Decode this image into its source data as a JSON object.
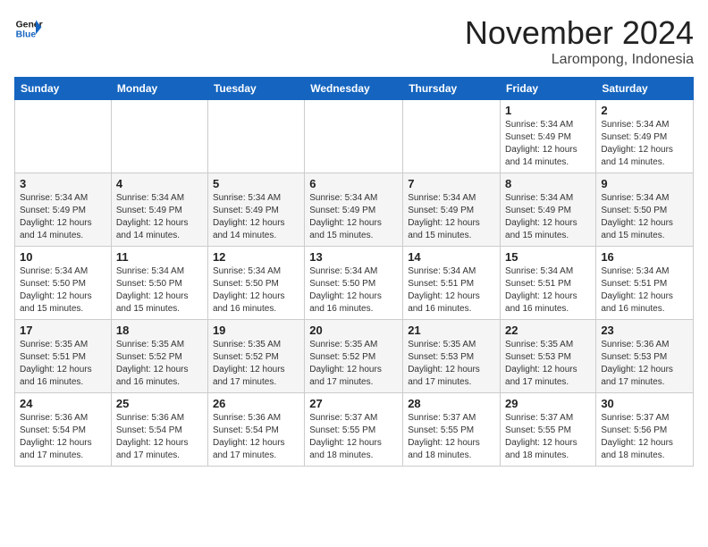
{
  "header": {
    "logo_line1": "General",
    "logo_line2": "Blue",
    "month": "November 2024",
    "location": "Larompong, Indonesia"
  },
  "days_of_week": [
    "Sunday",
    "Monday",
    "Tuesday",
    "Wednesday",
    "Thursday",
    "Friday",
    "Saturday"
  ],
  "weeks": [
    [
      {
        "day": "",
        "info": ""
      },
      {
        "day": "",
        "info": ""
      },
      {
        "day": "",
        "info": ""
      },
      {
        "day": "",
        "info": ""
      },
      {
        "day": "",
        "info": ""
      },
      {
        "day": "1",
        "info": "Sunrise: 5:34 AM\nSunset: 5:49 PM\nDaylight: 12 hours\nand 14 minutes."
      },
      {
        "day": "2",
        "info": "Sunrise: 5:34 AM\nSunset: 5:49 PM\nDaylight: 12 hours\nand 14 minutes."
      }
    ],
    [
      {
        "day": "3",
        "info": "Sunrise: 5:34 AM\nSunset: 5:49 PM\nDaylight: 12 hours\nand 14 minutes."
      },
      {
        "day": "4",
        "info": "Sunrise: 5:34 AM\nSunset: 5:49 PM\nDaylight: 12 hours\nand 14 minutes."
      },
      {
        "day": "5",
        "info": "Sunrise: 5:34 AM\nSunset: 5:49 PM\nDaylight: 12 hours\nand 14 minutes."
      },
      {
        "day": "6",
        "info": "Sunrise: 5:34 AM\nSunset: 5:49 PM\nDaylight: 12 hours\nand 15 minutes."
      },
      {
        "day": "7",
        "info": "Sunrise: 5:34 AM\nSunset: 5:49 PM\nDaylight: 12 hours\nand 15 minutes."
      },
      {
        "day": "8",
        "info": "Sunrise: 5:34 AM\nSunset: 5:49 PM\nDaylight: 12 hours\nand 15 minutes."
      },
      {
        "day": "9",
        "info": "Sunrise: 5:34 AM\nSunset: 5:50 PM\nDaylight: 12 hours\nand 15 minutes."
      }
    ],
    [
      {
        "day": "10",
        "info": "Sunrise: 5:34 AM\nSunset: 5:50 PM\nDaylight: 12 hours\nand 15 minutes."
      },
      {
        "day": "11",
        "info": "Sunrise: 5:34 AM\nSunset: 5:50 PM\nDaylight: 12 hours\nand 15 minutes."
      },
      {
        "day": "12",
        "info": "Sunrise: 5:34 AM\nSunset: 5:50 PM\nDaylight: 12 hours\nand 16 minutes."
      },
      {
        "day": "13",
        "info": "Sunrise: 5:34 AM\nSunset: 5:50 PM\nDaylight: 12 hours\nand 16 minutes."
      },
      {
        "day": "14",
        "info": "Sunrise: 5:34 AM\nSunset: 5:51 PM\nDaylight: 12 hours\nand 16 minutes."
      },
      {
        "day": "15",
        "info": "Sunrise: 5:34 AM\nSunset: 5:51 PM\nDaylight: 12 hours\nand 16 minutes."
      },
      {
        "day": "16",
        "info": "Sunrise: 5:34 AM\nSunset: 5:51 PM\nDaylight: 12 hours\nand 16 minutes."
      }
    ],
    [
      {
        "day": "17",
        "info": "Sunrise: 5:35 AM\nSunset: 5:51 PM\nDaylight: 12 hours\nand 16 minutes."
      },
      {
        "day": "18",
        "info": "Sunrise: 5:35 AM\nSunset: 5:52 PM\nDaylight: 12 hours\nand 16 minutes."
      },
      {
        "day": "19",
        "info": "Sunrise: 5:35 AM\nSunset: 5:52 PM\nDaylight: 12 hours\nand 17 minutes."
      },
      {
        "day": "20",
        "info": "Sunrise: 5:35 AM\nSunset: 5:52 PM\nDaylight: 12 hours\nand 17 minutes."
      },
      {
        "day": "21",
        "info": "Sunrise: 5:35 AM\nSunset: 5:53 PM\nDaylight: 12 hours\nand 17 minutes."
      },
      {
        "day": "22",
        "info": "Sunrise: 5:35 AM\nSunset: 5:53 PM\nDaylight: 12 hours\nand 17 minutes."
      },
      {
        "day": "23",
        "info": "Sunrise: 5:36 AM\nSunset: 5:53 PM\nDaylight: 12 hours\nand 17 minutes."
      }
    ],
    [
      {
        "day": "24",
        "info": "Sunrise: 5:36 AM\nSunset: 5:54 PM\nDaylight: 12 hours\nand 17 minutes."
      },
      {
        "day": "25",
        "info": "Sunrise: 5:36 AM\nSunset: 5:54 PM\nDaylight: 12 hours\nand 17 minutes."
      },
      {
        "day": "26",
        "info": "Sunrise: 5:36 AM\nSunset: 5:54 PM\nDaylight: 12 hours\nand 17 minutes."
      },
      {
        "day": "27",
        "info": "Sunrise: 5:37 AM\nSunset: 5:55 PM\nDaylight: 12 hours\nand 18 minutes."
      },
      {
        "day": "28",
        "info": "Sunrise: 5:37 AM\nSunset: 5:55 PM\nDaylight: 12 hours\nand 18 minutes."
      },
      {
        "day": "29",
        "info": "Sunrise: 5:37 AM\nSunset: 5:55 PM\nDaylight: 12 hours\nand 18 minutes."
      },
      {
        "day": "30",
        "info": "Sunrise: 5:37 AM\nSunset: 5:56 PM\nDaylight: 12 hours\nand 18 minutes."
      }
    ]
  ]
}
